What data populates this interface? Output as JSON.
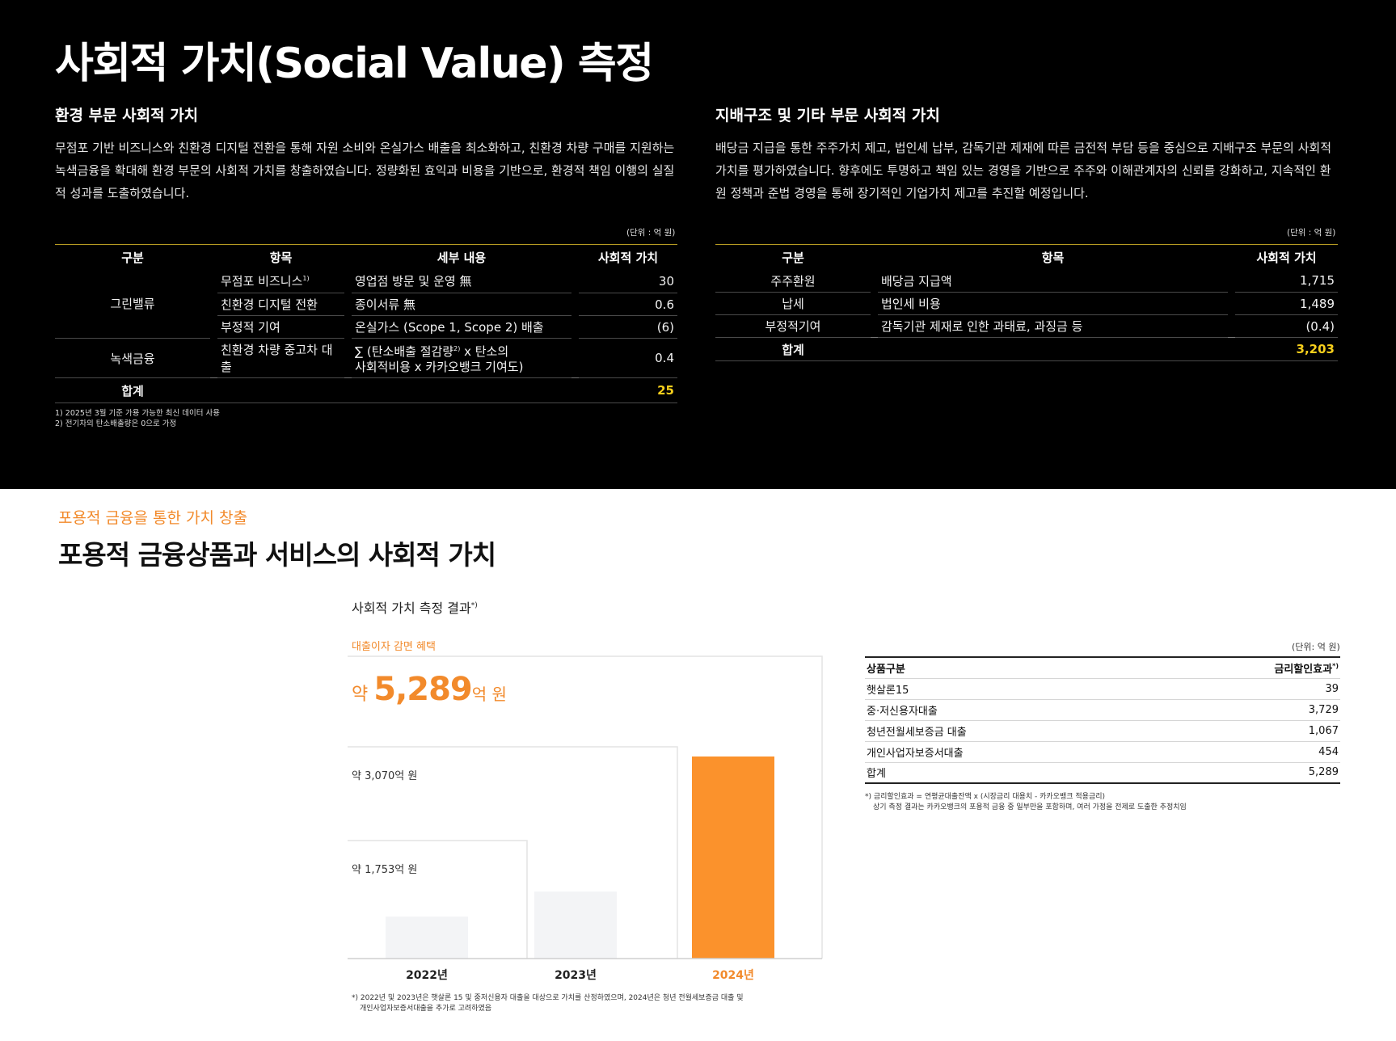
{
  "title": "사회적 가치(Social Value) 측정",
  "environment": {
    "heading": "환경 부문 사회적 가치",
    "paragraph": "무점포 기반 비즈니스와 친환경 디지털 전환을 통해 자원 소비와 온실가스 배출을 최소화하고, 친환경 차량 구매를 지원하는 녹색금융을 확대해 환경 부문의 사회적 가치를 창출하였습니다. 정량화된 효익과 비용을 기반으로, 환경적 책임 이행의 실질적 성과를 도출하였습니다.",
    "unit": "(단위 : 억 원)",
    "headers": [
      "구분",
      "항목",
      "세부 내용",
      "사회적 가치"
    ],
    "group1": "그린밸류",
    "group2": "녹색금융",
    "rows": [
      {
        "item": "무점포 비즈니스",
        "sup": "1)",
        "detail": "영업점 방문 및 운영 無",
        "value": "30"
      },
      {
        "item": "친환경 디지털 전환",
        "sup": "",
        "detail": "종이서류 無",
        "value": "0.6"
      },
      {
        "item": "부정적 기여",
        "sup": "",
        "detail": "온실가스 (Scope 1, Scope 2) 배출",
        "value": "(6)"
      },
      {
        "item": "친환경 차량 중고차 대출",
        "sup": "",
        "detail": "∑ (탄소배출 절감량2) x 탄소의 사회적비용 x 카카오뱅크 기여도)",
        "value": "0.4"
      }
    ],
    "detail4_a": "∑ (탄소배출 절감량",
    "detail4_sup": "2)",
    "detail4_b": " x 탄소의",
    "detail4_c": "사회적비용 x 카카오뱅크 기여도)",
    "total_label": "합계",
    "total_value": "25",
    "footnote1": "1) 2025년 3월 기준 가용 가능한 최신 데이터 사용",
    "footnote2": "2) 전기차의 탄소배출량은 0으로 가정"
  },
  "governance": {
    "heading": "지배구조 및 기타 부문 사회적 가치",
    "paragraph": "배당금 지급을 통한 주주가치 제고, 법인세 납부, 감독기관 제재에 따른 금전적 부담 등을 중심으로 지배구조 부문의 사회적 가치를 평가하였습니다. 향후에도 투명하고 책임 있는 경영을 기반으로 주주와 이해관계자의 신뢰를 강화하고, 지속적인 환원 정책과 준법 경영을 통해 장기적인 기업가치 제고를 추진할 예정입니다.",
    "unit": "(단위 : 억 원)",
    "headers": [
      "구분",
      "항목",
      "사회적 가치"
    ],
    "rows": [
      {
        "category": "주주환원",
        "item": "배당금 지급액",
        "value": "1,715"
      },
      {
        "category": "납세",
        "item": "법인세 비용",
        "value": "1,489"
      },
      {
        "category": "부정적기여",
        "item": "감독기관 제재로 인한 과태료, 과징금 등",
        "value": "(0.4)"
      }
    ],
    "total_label": "합계",
    "total_value": "3,203"
  },
  "inclusive": {
    "subheading": "포용적 금융을 통한 가치 창출",
    "title": "포용적 금융상품과 서비스의 사회적 가치",
    "chart_title": "사회적 가치 측정 결과",
    "chart_title_sup": "*)",
    "benefit_label": "대출이자 감면 혜택",
    "big_prefix": "약 ",
    "big_value": "5,289",
    "big_suffix": "억 원",
    "chart_footnote_1": "*) 2022년 및 2023년은 햇살론 15 및 중저신용자 대출을 대상으로 가치를 산정하였으며, 2024년은 청년 전월세보증금 대출 및",
    "chart_footnote_2": "개인사업자보증서대출을 추가로 고려하였음",
    "table_unit": "(단위: 억 원)",
    "table_headers": [
      "상품구분",
      "금리할인효과"
    ],
    "table_header_sup": "*)",
    "table_rows": [
      {
        "name": "햇살론15",
        "value": "39"
      },
      {
        "name": "중·저신용자대출",
        "value": "3,729"
      },
      {
        "name": "청년전월세보증금 대출",
        "value": "1,067"
      },
      {
        "name": "개인사업자보증서대출",
        "value": "454"
      },
      {
        "name": "합계",
        "value": "5,289"
      }
    ],
    "table_footnote_1": "*) 금리할인효과 = 연평균대출잔액 x (시장금리 대용치 - 카카오뱅크 적용금리)",
    "table_footnote_2": "상기 측정 결과는 카카오뱅크의 포용적 금융 중 일부만을 포함하며, 여러 가정을 전제로 도출한 추정치임"
  },
  "chart_data": {
    "type": "bar",
    "categories": [
      "2022년",
      "2023년",
      "2024년"
    ],
    "values": [
      1100,
      1753,
      5289
    ],
    "value_labels": [
      "약 1,753억 원",
      "약 3,070억 원"
    ],
    "colors": {
      "past": "#f3f4f6",
      "highlight": "#fb922c",
      "accent_text": "#f28a2b"
    }
  }
}
